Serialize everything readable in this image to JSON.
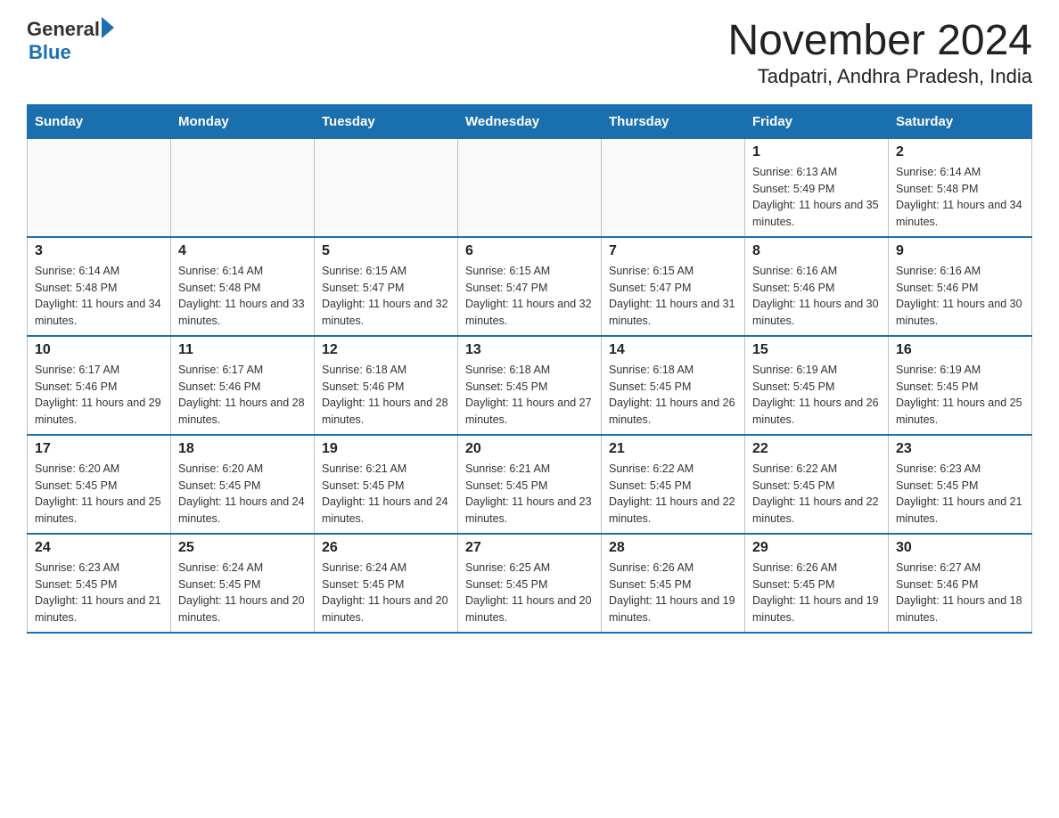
{
  "header": {
    "logo_general": "General",
    "logo_blue": "Blue",
    "title": "November 2024",
    "subtitle": "Tadpatri, Andhra Pradesh, India"
  },
  "days_of_week": [
    "Sunday",
    "Monday",
    "Tuesday",
    "Wednesday",
    "Thursday",
    "Friday",
    "Saturday"
  ],
  "weeks": [
    [
      {
        "day": "",
        "info": ""
      },
      {
        "day": "",
        "info": ""
      },
      {
        "day": "",
        "info": ""
      },
      {
        "day": "",
        "info": ""
      },
      {
        "day": "",
        "info": ""
      },
      {
        "day": "1",
        "info": "Sunrise: 6:13 AM\nSunset: 5:49 PM\nDaylight: 11 hours and 35 minutes."
      },
      {
        "day": "2",
        "info": "Sunrise: 6:14 AM\nSunset: 5:48 PM\nDaylight: 11 hours and 34 minutes."
      }
    ],
    [
      {
        "day": "3",
        "info": "Sunrise: 6:14 AM\nSunset: 5:48 PM\nDaylight: 11 hours and 34 minutes."
      },
      {
        "day": "4",
        "info": "Sunrise: 6:14 AM\nSunset: 5:48 PM\nDaylight: 11 hours and 33 minutes."
      },
      {
        "day": "5",
        "info": "Sunrise: 6:15 AM\nSunset: 5:47 PM\nDaylight: 11 hours and 32 minutes."
      },
      {
        "day": "6",
        "info": "Sunrise: 6:15 AM\nSunset: 5:47 PM\nDaylight: 11 hours and 32 minutes."
      },
      {
        "day": "7",
        "info": "Sunrise: 6:15 AM\nSunset: 5:47 PM\nDaylight: 11 hours and 31 minutes."
      },
      {
        "day": "8",
        "info": "Sunrise: 6:16 AM\nSunset: 5:46 PM\nDaylight: 11 hours and 30 minutes."
      },
      {
        "day": "9",
        "info": "Sunrise: 6:16 AM\nSunset: 5:46 PM\nDaylight: 11 hours and 30 minutes."
      }
    ],
    [
      {
        "day": "10",
        "info": "Sunrise: 6:17 AM\nSunset: 5:46 PM\nDaylight: 11 hours and 29 minutes."
      },
      {
        "day": "11",
        "info": "Sunrise: 6:17 AM\nSunset: 5:46 PM\nDaylight: 11 hours and 28 minutes."
      },
      {
        "day": "12",
        "info": "Sunrise: 6:18 AM\nSunset: 5:46 PM\nDaylight: 11 hours and 28 minutes."
      },
      {
        "day": "13",
        "info": "Sunrise: 6:18 AM\nSunset: 5:45 PM\nDaylight: 11 hours and 27 minutes."
      },
      {
        "day": "14",
        "info": "Sunrise: 6:18 AM\nSunset: 5:45 PM\nDaylight: 11 hours and 26 minutes."
      },
      {
        "day": "15",
        "info": "Sunrise: 6:19 AM\nSunset: 5:45 PM\nDaylight: 11 hours and 26 minutes."
      },
      {
        "day": "16",
        "info": "Sunrise: 6:19 AM\nSunset: 5:45 PM\nDaylight: 11 hours and 25 minutes."
      }
    ],
    [
      {
        "day": "17",
        "info": "Sunrise: 6:20 AM\nSunset: 5:45 PM\nDaylight: 11 hours and 25 minutes."
      },
      {
        "day": "18",
        "info": "Sunrise: 6:20 AM\nSunset: 5:45 PM\nDaylight: 11 hours and 24 minutes."
      },
      {
        "day": "19",
        "info": "Sunrise: 6:21 AM\nSunset: 5:45 PM\nDaylight: 11 hours and 24 minutes."
      },
      {
        "day": "20",
        "info": "Sunrise: 6:21 AM\nSunset: 5:45 PM\nDaylight: 11 hours and 23 minutes."
      },
      {
        "day": "21",
        "info": "Sunrise: 6:22 AM\nSunset: 5:45 PM\nDaylight: 11 hours and 22 minutes."
      },
      {
        "day": "22",
        "info": "Sunrise: 6:22 AM\nSunset: 5:45 PM\nDaylight: 11 hours and 22 minutes."
      },
      {
        "day": "23",
        "info": "Sunrise: 6:23 AM\nSunset: 5:45 PM\nDaylight: 11 hours and 21 minutes."
      }
    ],
    [
      {
        "day": "24",
        "info": "Sunrise: 6:23 AM\nSunset: 5:45 PM\nDaylight: 11 hours and 21 minutes."
      },
      {
        "day": "25",
        "info": "Sunrise: 6:24 AM\nSunset: 5:45 PM\nDaylight: 11 hours and 20 minutes."
      },
      {
        "day": "26",
        "info": "Sunrise: 6:24 AM\nSunset: 5:45 PM\nDaylight: 11 hours and 20 minutes."
      },
      {
        "day": "27",
        "info": "Sunrise: 6:25 AM\nSunset: 5:45 PM\nDaylight: 11 hours and 20 minutes."
      },
      {
        "day": "28",
        "info": "Sunrise: 6:26 AM\nSunset: 5:45 PM\nDaylight: 11 hours and 19 minutes."
      },
      {
        "day": "29",
        "info": "Sunrise: 6:26 AM\nSunset: 5:45 PM\nDaylight: 11 hours and 19 minutes."
      },
      {
        "day": "30",
        "info": "Sunrise: 6:27 AM\nSunset: 5:46 PM\nDaylight: 11 hours and 18 minutes."
      }
    ]
  ]
}
